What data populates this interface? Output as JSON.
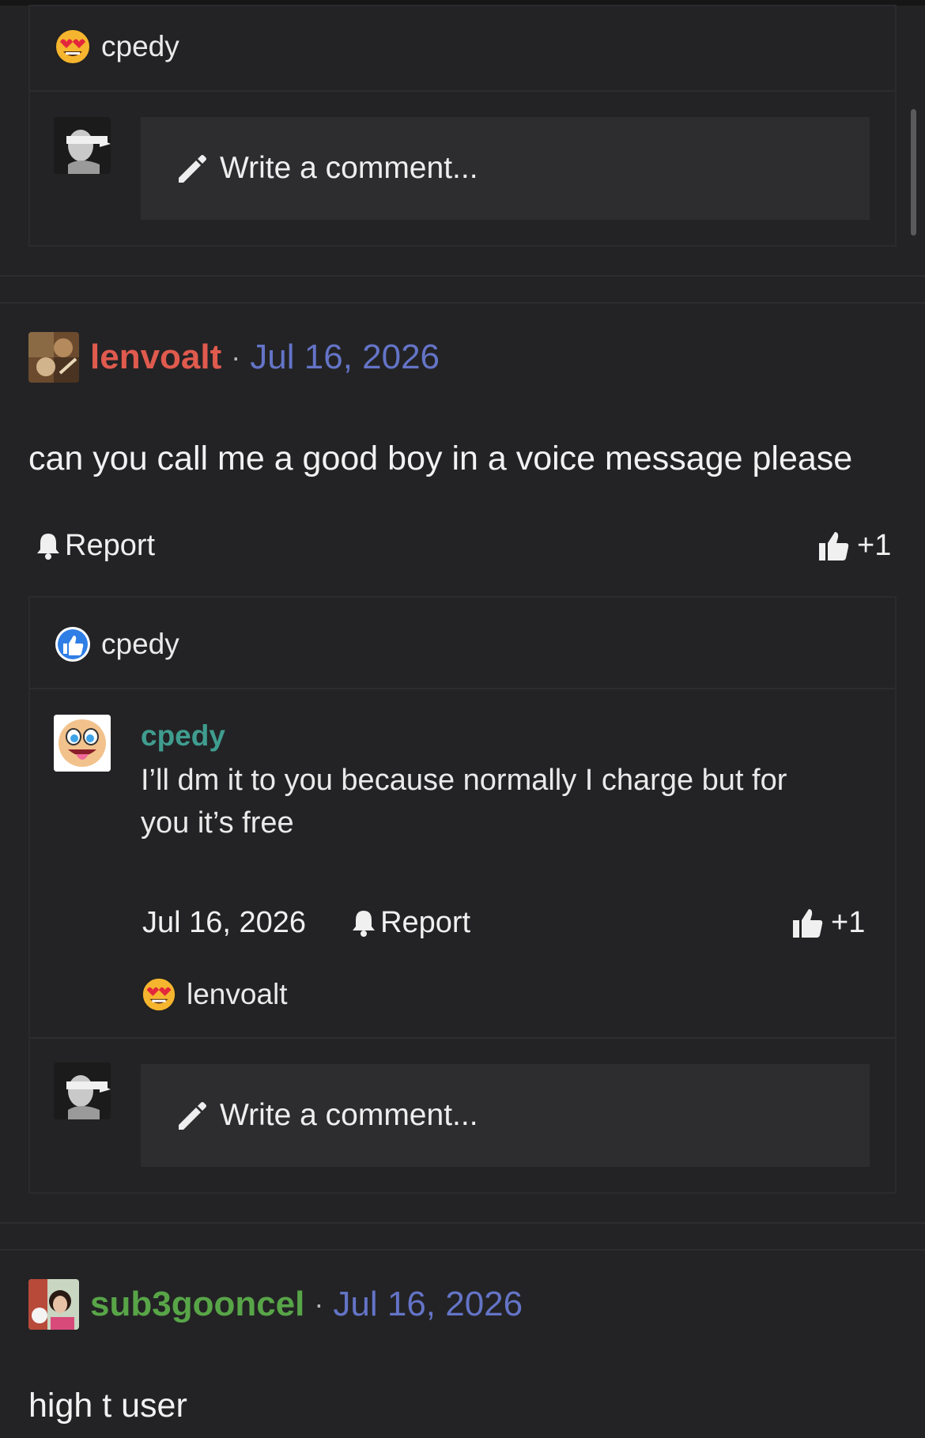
{
  "top_block": {
    "reaction_user": "cpedy",
    "write_placeholder": "Write a comment..."
  },
  "comments": [
    {
      "username": "lenvoalt",
      "separator": "·",
      "date": "Jul 16, 2026",
      "text": "can you call me a good boy in a voice message please",
      "report_label": "Report",
      "like_count": "+1",
      "like_reaction_user": "cpedy",
      "reply": {
        "username": "cpedy",
        "text_line1": "I’ll dm it to you because normally I charge but for",
        "text_line2": "you it’s free",
        "date": "Jul 16, 2026",
        "report_label": "Report",
        "like_count": "+1",
        "reaction_user": "lenvoalt"
      },
      "write_placeholder": "Write a comment..."
    },
    {
      "username": "sub3gooncel",
      "separator": "·",
      "date": "Jul 16, 2026",
      "text": "high t user"
    }
  ],
  "colors": {
    "background": "#232325",
    "username_red": "#e05a4e",
    "username_green": "#58a548",
    "username_teal": "#3f9d8f",
    "date_blue": "#6474c7"
  },
  "icons": [
    "heart-eyes-emoji-icon",
    "pencil-icon",
    "bell-icon",
    "thumbs-up-icon",
    "like-badge-icon"
  ]
}
